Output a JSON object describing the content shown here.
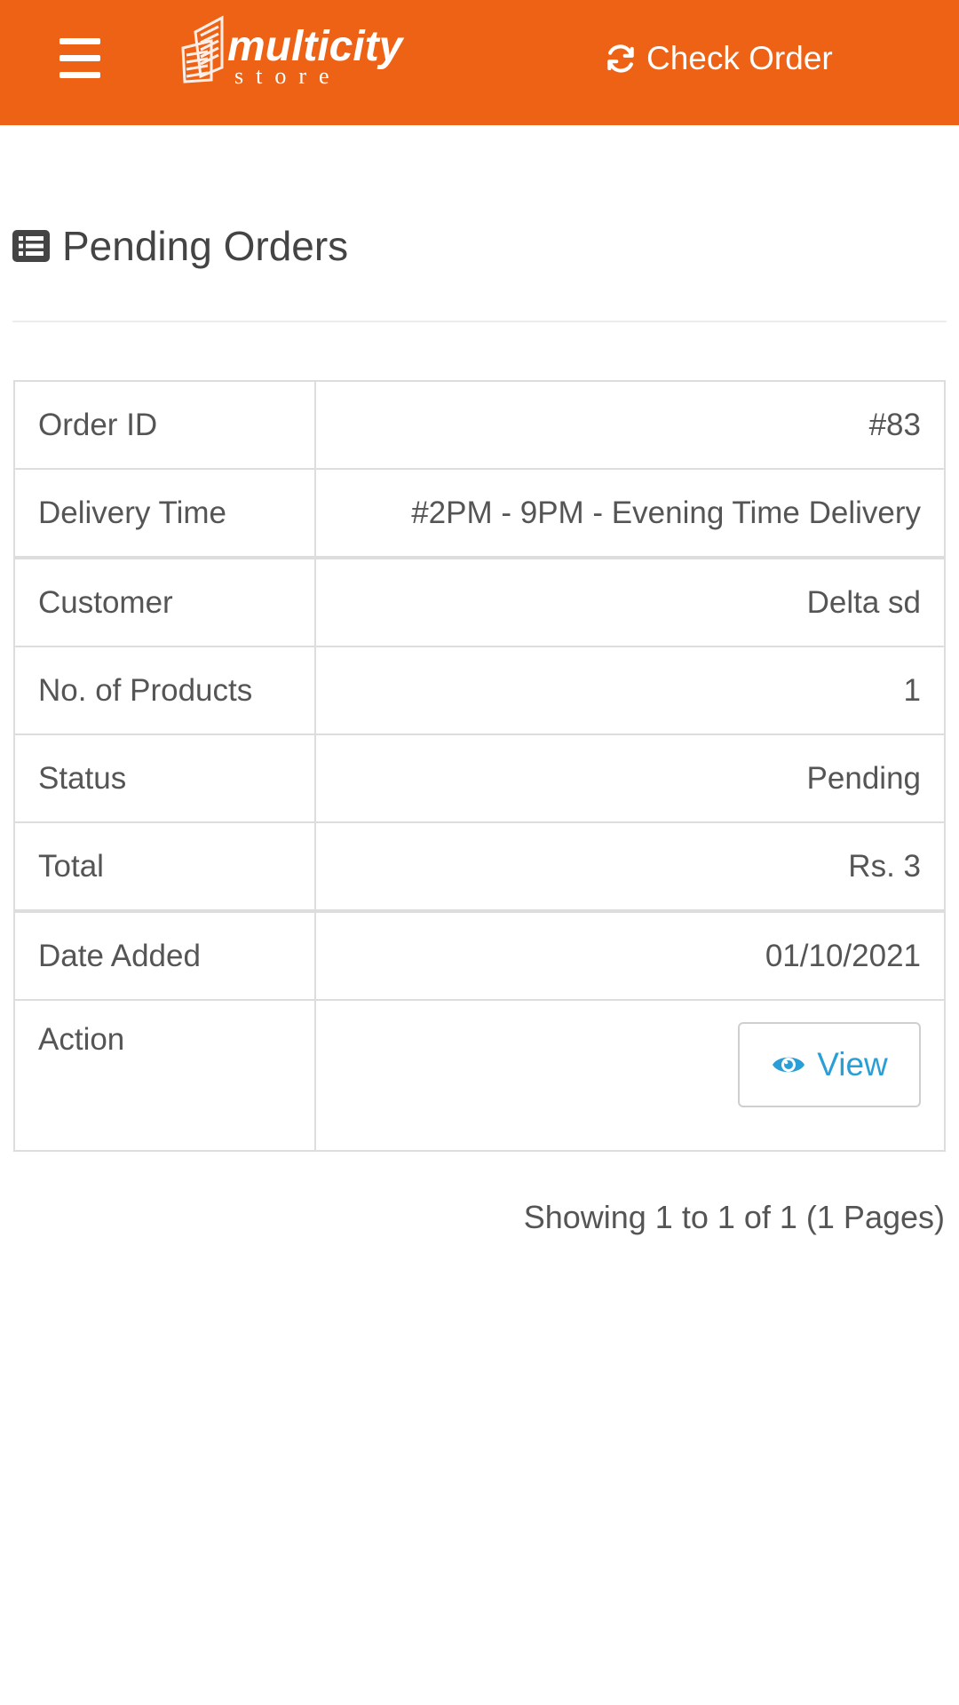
{
  "header": {
    "logo_text": "multicity",
    "logo_subtext": "store",
    "check_order_label": "Check Order"
  },
  "page": {
    "title": "Pending Orders"
  },
  "order": {
    "rows": [
      {
        "label": "Order ID",
        "value": "#83"
      },
      {
        "label": "Delivery Time",
        "value": "#2PM - 9PM - Evening Time Delivery"
      },
      {
        "label": "Customer",
        "value": "Delta sd"
      },
      {
        "label": "No. of Products",
        "value": "1"
      },
      {
        "label": "Status",
        "value": "Pending"
      },
      {
        "label": "Total",
        "value": "Rs. 3"
      },
      {
        "label": "Date Added",
        "value": "01/10/2021"
      },
      {
        "label": "Action",
        "value": ""
      }
    ],
    "view_label": "View"
  },
  "pagination": {
    "text": "Showing 1 to 1 of 1 (1 Pages)"
  },
  "colors": {
    "brand": "#ee6216",
    "link": "#2a9fd6"
  }
}
